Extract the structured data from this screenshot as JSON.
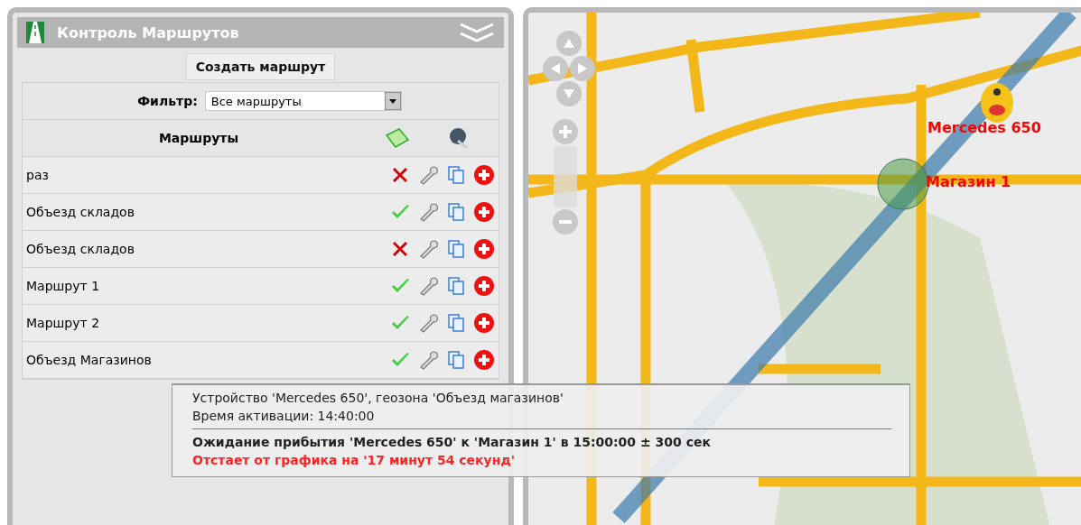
{
  "panel": {
    "title": "Контроль Маршрутов",
    "create_button": "Создать маршрут",
    "filter": {
      "label": "Фильтр:",
      "value": "Все маршруты"
    },
    "table": {
      "column": "Маршруты"
    },
    "routes": [
      {
        "name": "раз",
        "active": false
      },
      {
        "name": "Объезд складов",
        "active": true
      },
      {
        "name": "Объезд складов",
        "active": false
      },
      {
        "name": "Маршрут 1",
        "active": true
      },
      {
        "name": "Маршрут 2",
        "active": true
      },
      {
        "name": "Объезд Магазинов",
        "active": true
      }
    ]
  },
  "map": {
    "vehicle_label": "Mercedes 650",
    "geozone_label": "Магазин 1"
  },
  "tooltip": {
    "lines": [
      {
        "kind": "plain",
        "text": "Устройство 'Mercedes 650', геозона 'Объезд магазинов'"
      },
      {
        "kind": "plain",
        "text": "Время активации: 14:40:00"
      },
      {
        "kind": "divider"
      },
      {
        "kind": "bold",
        "text": "Ожидание прибытия 'Mercedes 650' к 'Магазин 1' в 15:00:00 ± 300 сек"
      },
      {
        "kind": "alert",
        "text": "Отстает от графика на '17 минут 54 секунд'"
      }
    ]
  }
}
